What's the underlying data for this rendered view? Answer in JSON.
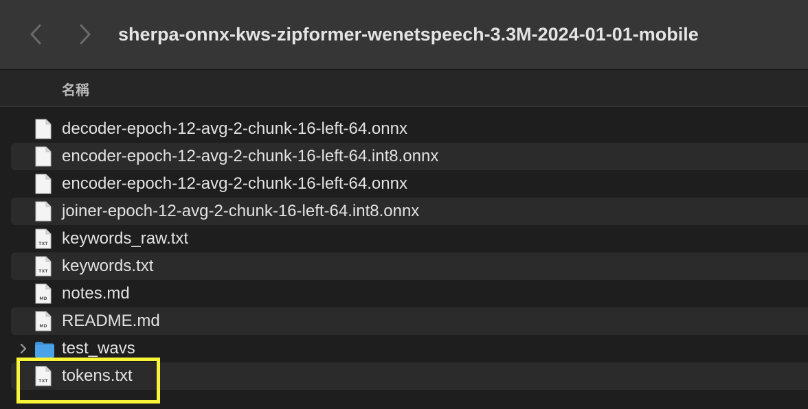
{
  "window": {
    "title": "sherpa-onnx-kws-zipformer-wenetspeech-3.3M-2024-01-01-mobile"
  },
  "column_header": {
    "name": "名稱"
  },
  "files": [
    {
      "name": "decoder-epoch-12-avg-2-chunk-16-left-64.onnx",
      "type": "document",
      "badge": ""
    },
    {
      "name": "encoder-epoch-12-avg-2-chunk-16-left-64.int8.onnx",
      "type": "document",
      "badge": ""
    },
    {
      "name": "encoder-epoch-12-avg-2-chunk-16-left-64.onnx",
      "type": "document",
      "badge": ""
    },
    {
      "name": "joiner-epoch-12-avg-2-chunk-16-left-64.int8.onnx",
      "type": "document",
      "badge": ""
    },
    {
      "name": "keywords_raw.txt",
      "type": "document",
      "badge": "TXT"
    },
    {
      "name": "keywords.txt",
      "type": "document",
      "badge": "TXT"
    },
    {
      "name": "notes.md",
      "type": "document",
      "badge": "MD"
    },
    {
      "name": "README.md",
      "type": "document",
      "badge": "MD"
    },
    {
      "name": "test_wavs",
      "type": "folder",
      "badge": ""
    },
    {
      "name": "tokens.txt",
      "type": "document",
      "badge": "TXT",
      "highlighted": true
    }
  ],
  "colors": {
    "highlight": "#f7f43a",
    "folder": "#4aa3e8",
    "toolbar": "#363636"
  }
}
